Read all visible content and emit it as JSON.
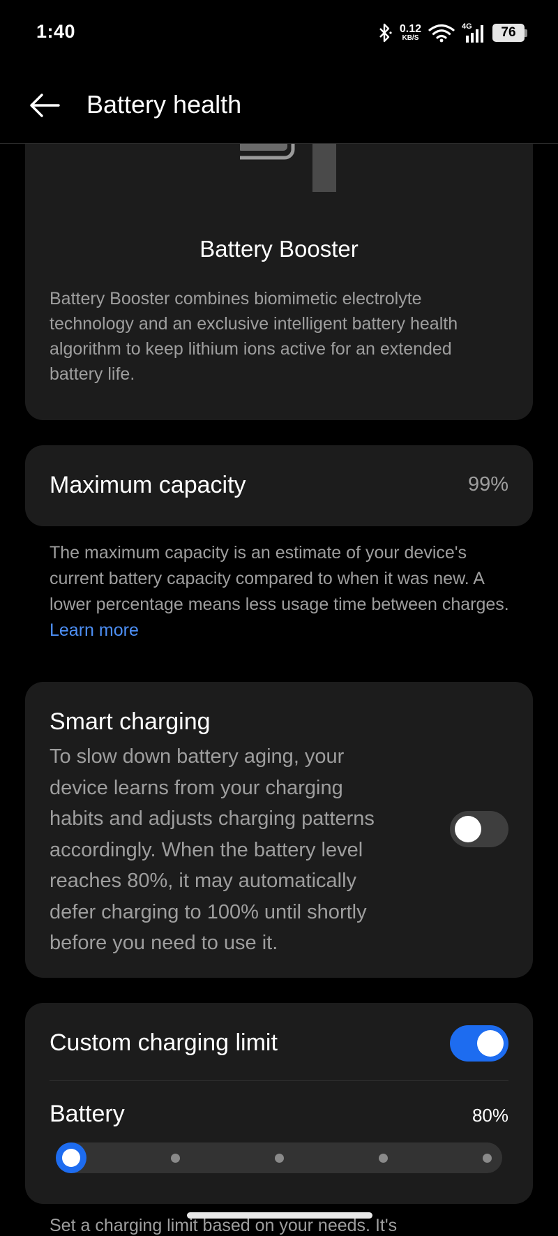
{
  "status_bar": {
    "time": "1:40",
    "net_speed_value": "0.12",
    "net_speed_unit": "KB/S",
    "network_type": "4G",
    "battery_level": "76"
  },
  "header": {
    "title": "Battery health"
  },
  "booster": {
    "title": "Battery Booster",
    "description": "Battery Booster combines biomimetic electrolyte technology and an exclusive intelligent battery health algorithm to keep lithium ions active for an extended battery life."
  },
  "capacity": {
    "label": "Maximum capacity",
    "value": "99%",
    "description": "The maximum capacity is an estimate of your device's current battery capacity compared to when it was new. A lower percentage means less usage time between charges.",
    "learn_more": "Learn more"
  },
  "smart_charging": {
    "title": "Smart charging",
    "description": "To slow down battery aging, your device learns from your charging habits and adjusts charging patterns accordingly. When the battery level reaches 80%, it may automatically defer charging to 100% until shortly before you need to use it.",
    "enabled": false
  },
  "custom_limit": {
    "title": "Custom charging limit",
    "enabled": true,
    "battery_label": "Battery",
    "battery_value": "80%",
    "slider_steps": 5,
    "slider_selected_index": 0
  },
  "footer": {
    "partial_text": "Set a charging limit based on your needs. It's"
  },
  "colors": {
    "accent": "#1d6cf0",
    "link": "#4d8ff5",
    "card_bg": "#1c1c1c",
    "secondary_text": "#9e9e9e"
  }
}
